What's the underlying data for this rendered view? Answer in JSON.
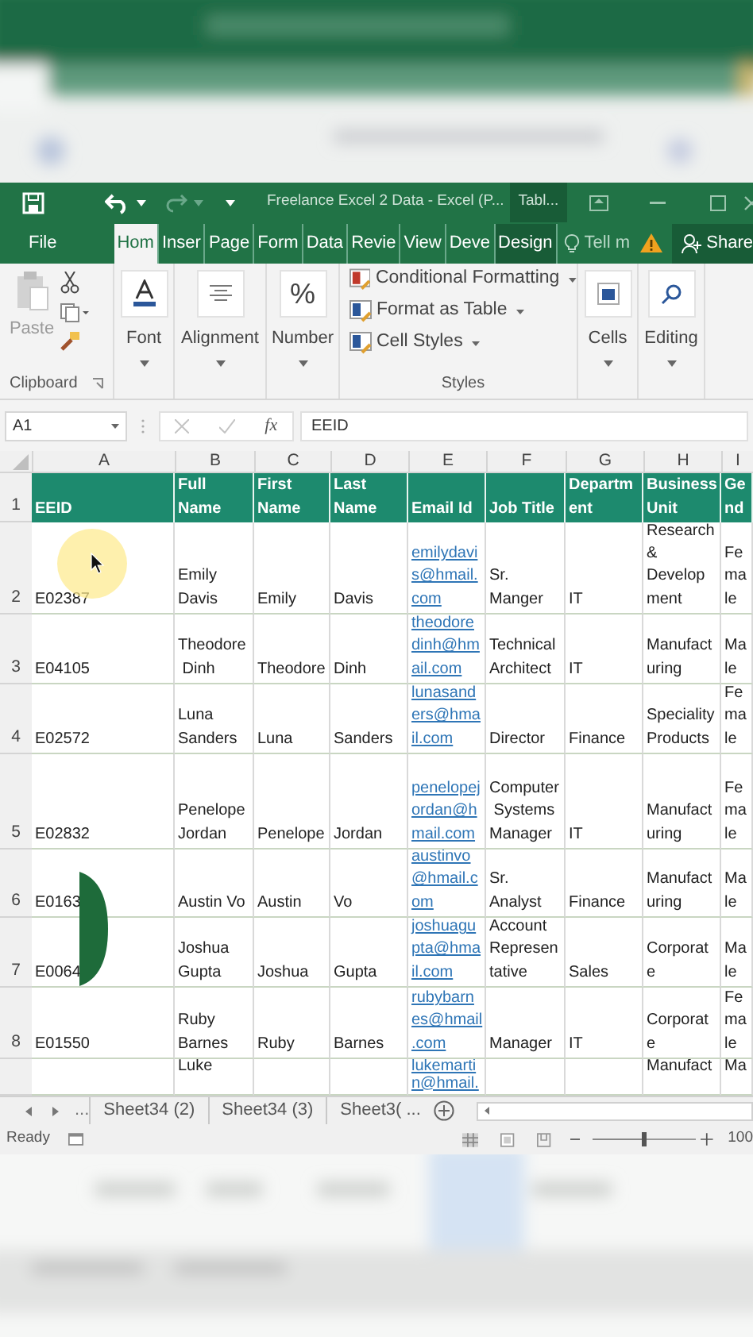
{
  "window": {
    "title": "Freelance Excel 2 Data - Excel (P...",
    "context_tab": "Tabl..."
  },
  "ribbon_tabs": [
    {
      "label": "File",
      "selected": false,
      "contextual": false
    },
    {
      "label": "Hom",
      "selected": true,
      "contextual": false
    },
    {
      "label": "Inser",
      "selected": false,
      "contextual": false
    },
    {
      "label": "Page",
      "selected": false,
      "contextual": false
    },
    {
      "label": "Form",
      "selected": false,
      "contextual": false
    },
    {
      "label": "Data",
      "selected": false,
      "contextual": false
    },
    {
      "label": "Revie",
      "selected": false,
      "contextual": false
    },
    {
      "label": "View",
      "selected": false,
      "contextual": false
    },
    {
      "label": "Deve",
      "selected": false,
      "contextual": false
    },
    {
      "label": "Design",
      "selected": false,
      "contextual": true
    }
  ],
  "tell_me": "Tell m",
  "share": "Share",
  "clipboard": {
    "label": "Clipboard",
    "paste": "Paste",
    "paste_disabled": true
  },
  "big_buttons": [
    {
      "label": "Font",
      "kind": "font"
    },
    {
      "label": "Alignment",
      "kind": "align"
    },
    {
      "label": "Number",
      "kind": "number",
      "symbol": "%"
    }
  ],
  "styles": {
    "label": "Styles",
    "items": [
      "Conditional Formatting",
      "Format as Table",
      "Cell Styles"
    ]
  },
  "end_buttons": [
    {
      "label": "Cells",
      "kind": "cells"
    },
    {
      "label": "Editing",
      "kind": "search"
    }
  ],
  "formula_bar": {
    "name_box": "A1",
    "fx": "fx",
    "value": "EEID"
  },
  "table": {
    "header_row_number": "1",
    "columns": [
      {
        "letter": "A",
        "header": "EEID",
        "kind": "text"
      },
      {
        "letter": "B",
        "header": "Full\nName",
        "kind": "text"
      },
      {
        "letter": "C",
        "header": "First\nName",
        "kind": "text"
      },
      {
        "letter": "D",
        "header": "Last\nName",
        "kind": "text"
      },
      {
        "letter": "E",
        "header": "Email Id",
        "kind": "email"
      },
      {
        "letter": "F",
        "header": "Job Title",
        "kind": "text"
      },
      {
        "letter": "G",
        "header": "Departm\nent",
        "kind": "text"
      },
      {
        "letter": "H",
        "header": "Business\nUnit",
        "kind": "text"
      },
      {
        "letter": "I",
        "header": "Ge\nnd",
        "kind": "text"
      }
    ],
    "rows": [
      {
        "number": "2",
        "cells": [
          "E02387",
          "Emily\nDavis",
          "Emily",
          "Davis",
          "emilydavi\ns@hmail.\ncom",
          "Sr.\nManger",
          "IT",
          "Research\n&\nDevelop\nment",
          "Fe\nma\nle"
        ]
      },
      {
        "number": "3",
        "cells": [
          "E04105",
          "Theodore\n Dinh",
          "Theodore",
          "Dinh",
          "theodore\ndinh@hm\nail.com",
          "Technical\nArchitect",
          "IT",
          "Manufact\nuring",
          "Ma\nle"
        ]
      },
      {
        "number": "4",
        "cells": [
          "E02572",
          "Luna\nSanders",
          "Luna",
          "Sanders",
          "lunasand\ners@hma\nil.com",
          "Director",
          "Finance",
          "Speciality\nProducts",
          "Fe\nma\nle"
        ]
      },
      {
        "number": "5",
        "cells": [
          "E02832",
          "Penelope\nJordan",
          "Penelope",
          "Jordan",
          "penelopej\nordan@h\nmail.com",
          "Computer\n Systems\nManager",
          "IT",
          "Manufact\nuring",
          "Fe\nma\nle"
        ]
      },
      {
        "number": "6",
        "cells": [
          "E0163",
          "Austin Vo",
          "Austin",
          "Vo",
          "austinvo\n@hmail.c\nom",
          "Sr.\nAnalyst",
          "Finance",
          "Manufact\nuring",
          "Ma\nle"
        ]
      },
      {
        "number": "7",
        "cells": [
          "E0064",
          "Joshua\nGupta",
          "Joshua",
          "Gupta",
          "joshuagu\npta@hma\nil.com",
          "Account\nRepresen\ntative",
          "Sales",
          "Corporat\ne",
          "Ma\nle"
        ]
      },
      {
        "number": "8",
        "cells": [
          "E01550",
          "Ruby\nBarnes",
          "Ruby",
          "Barnes",
          "rubybarn\nes@hmail\n.com",
          "Manager",
          "IT",
          "Corporat\ne",
          "Fe\nma\nle"
        ]
      },
      {
        "number": "",
        "cells": [
          "",
          "Luke",
          "",
          "",
          "lukemarti\nn@hmail.",
          "",
          "",
          "Manufact",
          "Ma"
        ]
      }
    ]
  },
  "sheet_tabs": {
    "more": "...",
    "tabs": [
      "Sheet34 (2)",
      "Sheet34 (3)",
      "Sheet3( ..."
    ]
  },
  "status_bar": {
    "status": "Ready",
    "zoom": {
      "level": 0.5,
      "reading": "100"
    }
  }
}
